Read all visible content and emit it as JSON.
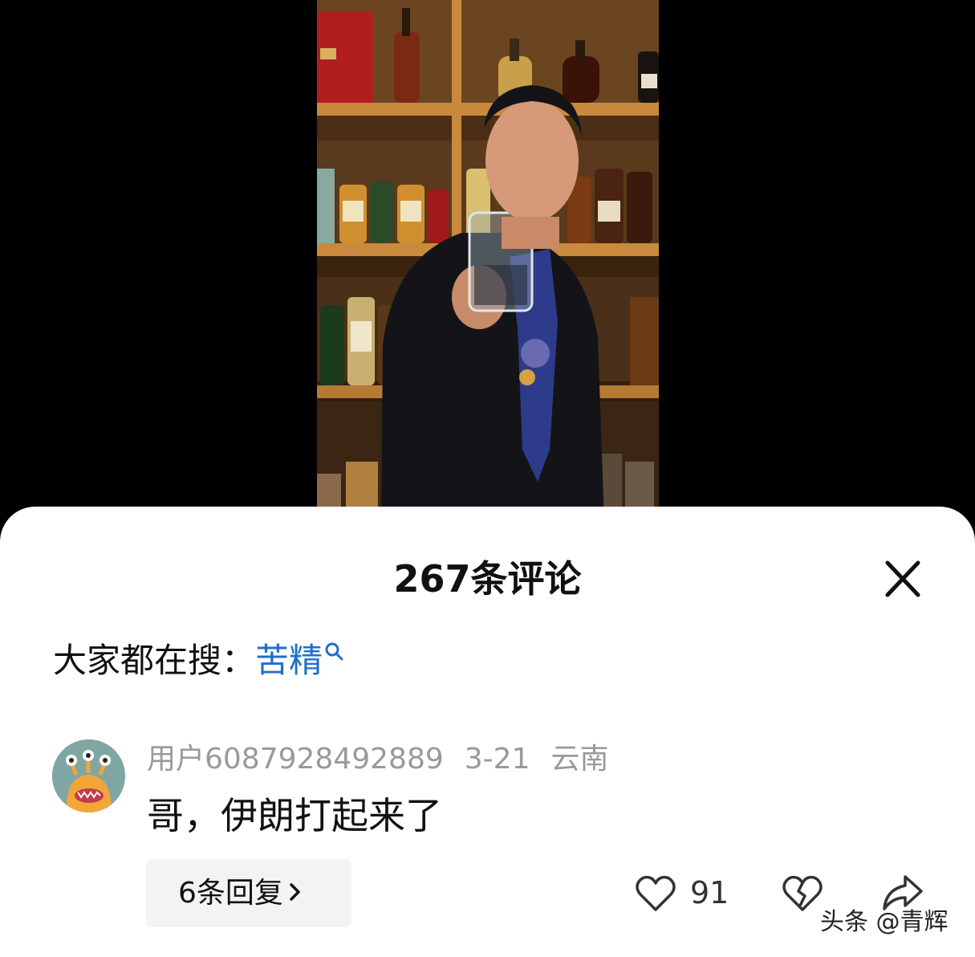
{
  "video": {
    "description_icon": "bartender-video-frame"
  },
  "comments_sheet": {
    "title": "267条评论",
    "close_icon": "close-icon",
    "search": {
      "prefix": "大家都在搜：",
      "term": "苦精",
      "icon": "search-icon"
    },
    "comment": {
      "avatar_icon": "monster-avatar-icon",
      "username": "用户6087928492889",
      "date": "3-21",
      "location": "云南",
      "text": "哥，伊朗打起来了",
      "replies_label": "6条回复",
      "replies_icon": "chevron-right-icon",
      "like_icon": "heart-icon",
      "like_count": "91",
      "dislike_icon": "broken-heart-icon",
      "share_icon": "share-icon"
    }
  },
  "watermark": "头条 @青辉",
  "colors": {
    "link_blue": "#1f6fc9",
    "meta_gray": "#999999",
    "reply_bg": "#f3f3f3",
    "avatar_bg": "#7fa6a3",
    "avatar_monster": "#f2a63a"
  }
}
